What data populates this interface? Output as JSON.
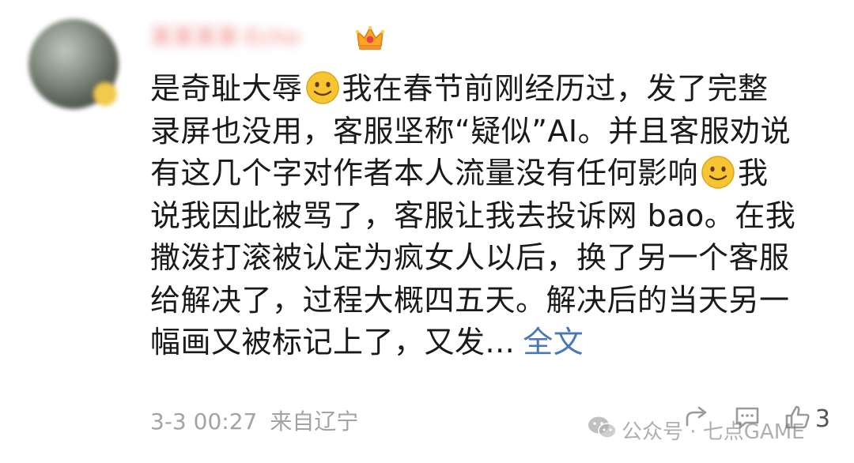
{
  "comment": {
    "username": "某某某某·Echo",
    "badge_icon": "crown-icon",
    "lines": [
      [
        "是奇耻大辱",
        "",
        "我在春节前刚经历过，发了完整"
      ],
      [
        "录屏也没用，客服坚称“疑似”AI。并且客服劝说"
      ],
      [
        "有这几个字对作者本人流量没有任何影响",
        "",
        "我"
      ],
      [
        "说我因此被骂了，客服让我去投诉网 bao。在我"
      ],
      [
        "撒泼打滚被认定为疯女人以后，换了另一个客服"
      ],
      [
        "给解决了，过程大概四五天。解决后的当天另一"
      ],
      [
        "幅画又被标记上了，又发..."
      ]
    ],
    "expand_link": "全文",
    "emoji_icon": "smiley-emoji-icon",
    "date": "3-3 00:27",
    "location": "来自辽宁",
    "like_count": "3"
  },
  "watermark": {
    "text": "公众号 · 七点GAME",
    "icon": "wechat-icon"
  },
  "colors": {
    "link": "#4a78b5",
    "meta": "#a3a3a3",
    "text": "#1a1a1a"
  }
}
